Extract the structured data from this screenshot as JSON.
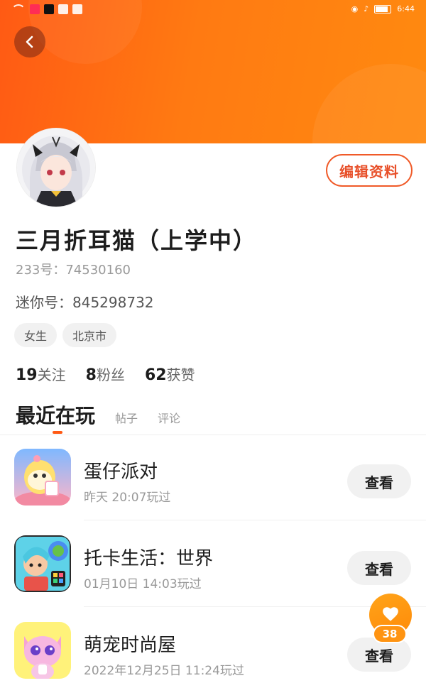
{
  "status_bar": {
    "time": "6:44"
  },
  "profile": {
    "edit_label": "编辑资料",
    "username": "三月折耳猫（上学中）",
    "id_label": "233号：",
    "id_value": "74530160",
    "mini_label": "迷你号：",
    "mini_value": "845298732",
    "tags": [
      "女生",
      "北京市"
    ],
    "stats": [
      {
        "num": "19",
        "label": "关注"
      },
      {
        "num": "8",
        "label": "粉丝"
      },
      {
        "num": "62",
        "label": "获赞"
      }
    ]
  },
  "tabs": [
    {
      "label": "最近在玩",
      "active": true
    },
    {
      "label": "帖子",
      "active": false
    },
    {
      "label": "评论",
      "active": false
    }
  ],
  "games": [
    {
      "name": "蛋仔派对",
      "played": "昨天 20:07玩过",
      "button": "查看",
      "icon": "eggy-party-icon"
    },
    {
      "name": "托卡生活：世界",
      "played": "01月10日 14:03玩过",
      "button": "查看",
      "icon": "toca-life-world-icon"
    },
    {
      "name": "萌宠时尚屋",
      "played": "2022年12月25日 11:24玩过",
      "button": "查看",
      "icon": "pet-fashion-house-icon"
    }
  ],
  "like": {
    "count": "38",
    "icon": "heart-icon"
  },
  "colors": {
    "accent": "#ff6a14",
    "edit_border": "#f05a28",
    "like": "#ff9412"
  }
}
